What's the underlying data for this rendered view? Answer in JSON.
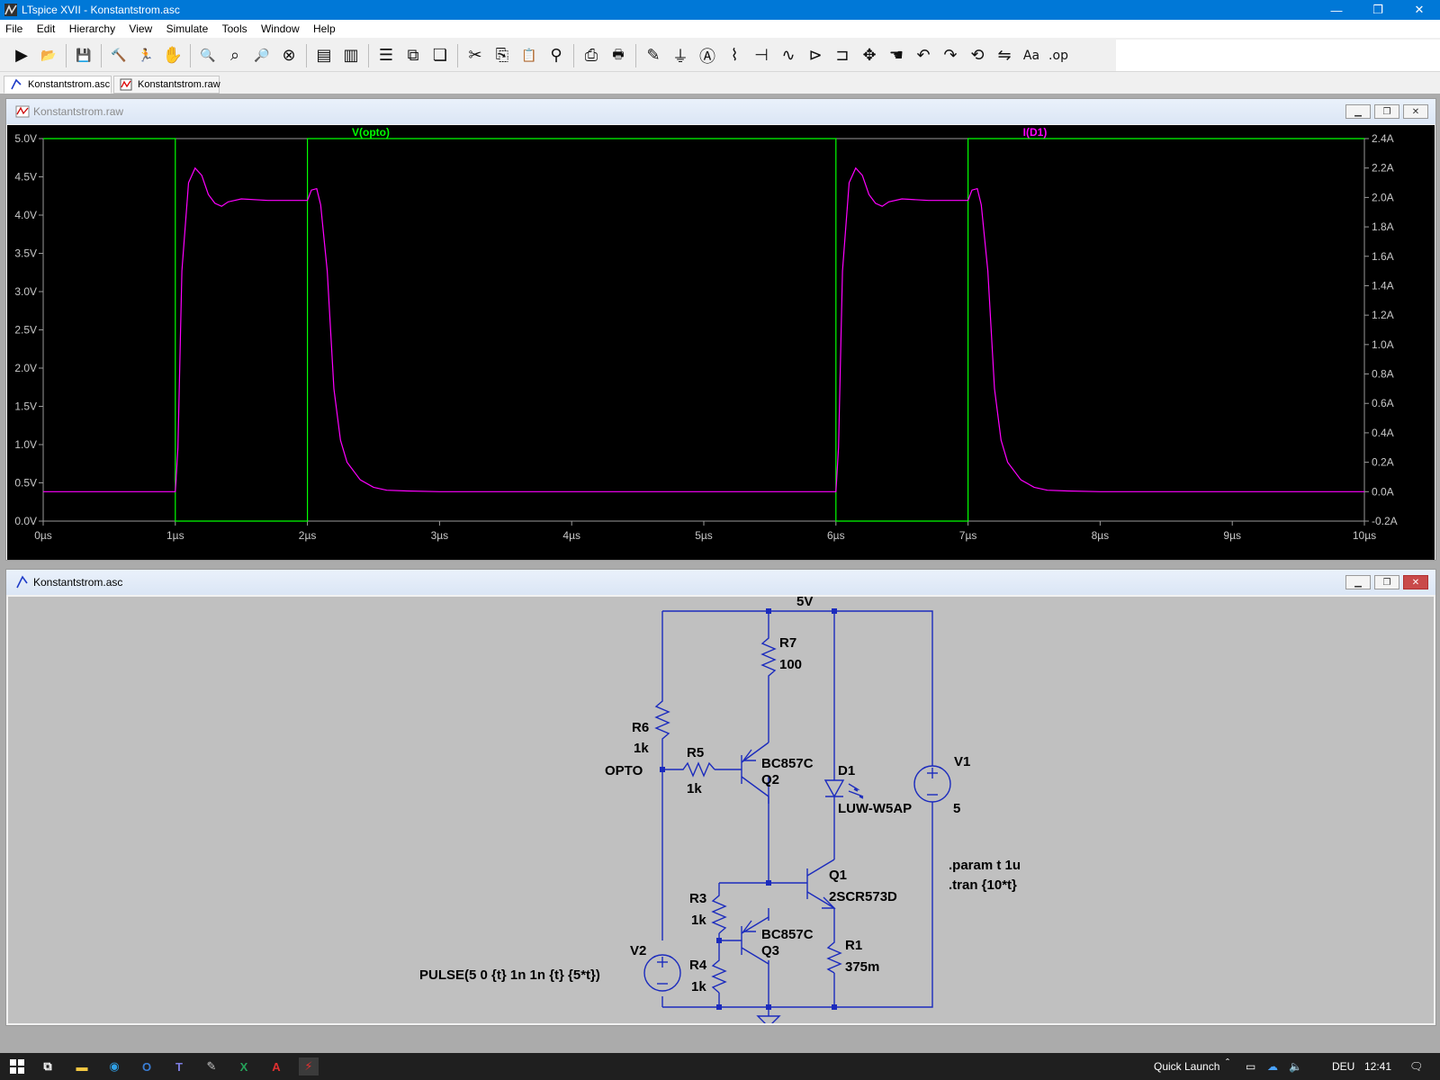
{
  "window": {
    "title": "LTspice XVII - Konstantstrom.asc",
    "minimize": "—",
    "restore": "❐",
    "close": "✕"
  },
  "menu": [
    "File",
    "Edit",
    "Hierarchy",
    "View",
    "Simulate",
    "Tools",
    "Window",
    "Help"
  ],
  "toolbar": {
    "groups": [
      [
        {
          "icon": "run-icon",
          "glyph": "▶"
        },
        {
          "icon": "open-icon",
          "glyph": "📂"
        }
      ],
      [
        {
          "icon": "save-icon",
          "glyph": "💾"
        }
      ],
      [
        {
          "icon": "control-panel-icon",
          "glyph": "🔨"
        },
        {
          "icon": "halt-icon",
          "glyph": "🏃"
        },
        {
          "icon": "pan-hand-icon",
          "glyph": "✋"
        }
      ],
      [
        {
          "icon": "zoom-in-icon",
          "glyph": "🔍"
        },
        {
          "icon": "zoom-full-icon",
          "glyph": "⌕"
        },
        {
          "icon": "zoom-out-icon",
          "glyph": "🔎"
        },
        {
          "icon": "zoom-cancel-icon",
          "glyph": "⊗"
        }
      ],
      [
        {
          "icon": "autorange-icon",
          "glyph": "▤"
        },
        {
          "icon": "waveform-icon",
          "glyph": "▥"
        }
      ],
      [
        {
          "icon": "tile-horizontal-icon",
          "glyph": "☰"
        },
        {
          "icon": "tile-vertical-icon",
          "glyph": "⧉"
        },
        {
          "icon": "cascade-icon",
          "glyph": "❏"
        }
      ],
      [
        {
          "icon": "cut-icon",
          "glyph": "✂"
        },
        {
          "icon": "copy-icon",
          "glyph": "⎘"
        },
        {
          "icon": "paste-icon",
          "glyph": "📋"
        },
        {
          "icon": "find-icon",
          "glyph": "⚲"
        }
      ],
      [
        {
          "icon": "print-icon",
          "glyph": "⎙"
        },
        {
          "icon": "print-setup-icon",
          "glyph": "🖶"
        }
      ],
      [
        {
          "icon": "draw-wire-icon",
          "glyph": "✎"
        },
        {
          "icon": "ground-icon",
          "glyph": "⏚"
        },
        {
          "icon": "label-net-icon",
          "glyph": "Ⓐ"
        },
        {
          "icon": "resistor-icon",
          "glyph": "⌇"
        },
        {
          "icon": "capacitor-icon",
          "glyph": "⊣"
        },
        {
          "icon": "inductor-icon",
          "glyph": "∿"
        },
        {
          "icon": "diode-icon",
          "glyph": "⊳"
        },
        {
          "icon": "component-icon",
          "glyph": "⊐"
        },
        {
          "icon": "move-icon",
          "glyph": "✥"
        },
        {
          "icon": "drag-icon",
          "glyph": "☚"
        },
        {
          "icon": "undo-icon",
          "glyph": "↶"
        },
        {
          "icon": "redo-icon",
          "glyph": "↷"
        },
        {
          "icon": "rotate-icon",
          "glyph": "⟲"
        },
        {
          "icon": "mirror-icon",
          "glyph": "⇋"
        },
        {
          "icon": "text-icon",
          "glyph": "Aa"
        },
        {
          "icon": "spice-directive-icon",
          "glyph": ".op"
        }
      ]
    ]
  },
  "tabs": [
    {
      "label": "Konstantstrom.asc",
      "active": true
    },
    {
      "label": "Konstantstrom.raw",
      "active": false
    }
  ],
  "waveform_window": {
    "title": "Konstantstrom.raw",
    "trace_labels": [
      {
        "label": "V(opto)",
        "color": "#00ff00"
      },
      {
        "label": "I(D1)",
        "color": "#ff00ff"
      }
    ]
  },
  "chart_data": {
    "type": "line",
    "title": "",
    "xlabel": "",
    "ylabel": "",
    "xlim": [
      0,
      10
    ],
    "ylim": [
      0,
      5
    ],
    "y2lim": [
      -0.2,
      2.4
    ],
    "grid": false,
    "background": "#000000",
    "x_ticks": [
      "0µs",
      "1µs",
      "2µs",
      "3µs",
      "4µs",
      "5µs",
      "6µs",
      "7µs",
      "8µs",
      "9µs",
      "10µs"
    ],
    "y_ticks": [
      "0.0V",
      "0.5V",
      "1.0V",
      "1.5V",
      "2.0V",
      "2.5V",
      "3.0V",
      "3.5V",
      "4.0V",
      "4.5V",
      "5.0V"
    ],
    "y2_ticks": [
      "-0.2A",
      "0.0A",
      "0.2A",
      "0.4A",
      "0.6A",
      "0.8A",
      "1.0A",
      "1.2A",
      "1.4A",
      "1.6A",
      "1.8A",
      "2.0A",
      "2.2A",
      "2.4A"
    ],
    "series": [
      {
        "name": "V(opto)",
        "color": "#00ff00",
        "axis": "left",
        "x": [
          0,
          1,
          1,
          2,
          2,
          6,
          6,
          7,
          7,
          10
        ],
        "y": [
          5,
          5,
          0,
          0,
          5,
          5,
          0,
          0,
          5,
          5
        ]
      },
      {
        "name": "I(D1)",
        "color": "#ff00ff",
        "axis": "right",
        "x": [
          0,
          1.0,
          1.02,
          1.05,
          1.1,
          1.15,
          1.2,
          1.25,
          1.3,
          1.35,
          1.4,
          1.5,
          1.7,
          2.0,
          2.03,
          2.07,
          2.1,
          2.15,
          2.2,
          2.25,
          2.3,
          2.4,
          2.5,
          2.6,
          2.75,
          3.0,
          6.0,
          6.02,
          6.05,
          6.1,
          6.15,
          6.2,
          6.25,
          6.3,
          6.35,
          6.4,
          6.5,
          6.7,
          7.0,
          7.03,
          7.07,
          7.1,
          7.15,
          7.2,
          7.25,
          7.3,
          7.4,
          7.5,
          7.6,
          7.75,
          8.0,
          10.0
        ],
        "y": [
          0,
          0,
          0.3,
          1.5,
          2.1,
          2.2,
          2.15,
          2.02,
          1.96,
          1.94,
          1.97,
          1.99,
          1.98,
          1.98,
          2.05,
          2.06,
          1.95,
          1.5,
          0.7,
          0.35,
          0.2,
          0.08,
          0.03,
          0.01,
          0.005,
          0,
          0,
          0.3,
          1.5,
          2.1,
          2.2,
          2.15,
          2.02,
          1.96,
          1.94,
          1.97,
          1.99,
          1.98,
          1.98,
          2.05,
          2.06,
          1.95,
          1.5,
          0.7,
          0.35,
          0.2,
          0.08,
          0.03,
          0.01,
          0.005,
          0,
          0
        ]
      }
    ]
  },
  "schematic_window": {
    "title": "Konstantstrom.asc",
    "labels": {
      "supply_net": "5V",
      "opto_net": "OPTO",
      "r7_name": "R7",
      "r7_value": "100",
      "r6_name": "R6",
      "r6_value": "1k",
      "r5_name": "R5",
      "r5_value": "1k",
      "q2_model": "BC857C",
      "q2_name": "Q2",
      "d1_name": "D1",
      "d1_model": "LUW-W5AP",
      "v1_name": "V1",
      "v1_value": "5",
      "q1_name": "Q1",
      "q1_model": "2SCR573D",
      "r3_name": "R3",
      "r3_value": "1k",
      "q3_model": "BC857C",
      "q3_name": "Q3",
      "r1_name": "R1",
      "r1_value": "375m",
      "r4_name": "R4",
      "r4_value": "1k",
      "v2_name": "V2",
      "v2_value": "PULSE(5 0 {t} 1n 1n {t} {5*t})",
      "directive_param": ".param t 1u",
      "directive_tran": ".tran {10*t}"
    }
  },
  "taskbar": {
    "quick_launch": "Quick Launch",
    "language": "DEU",
    "time": "12:41"
  }
}
